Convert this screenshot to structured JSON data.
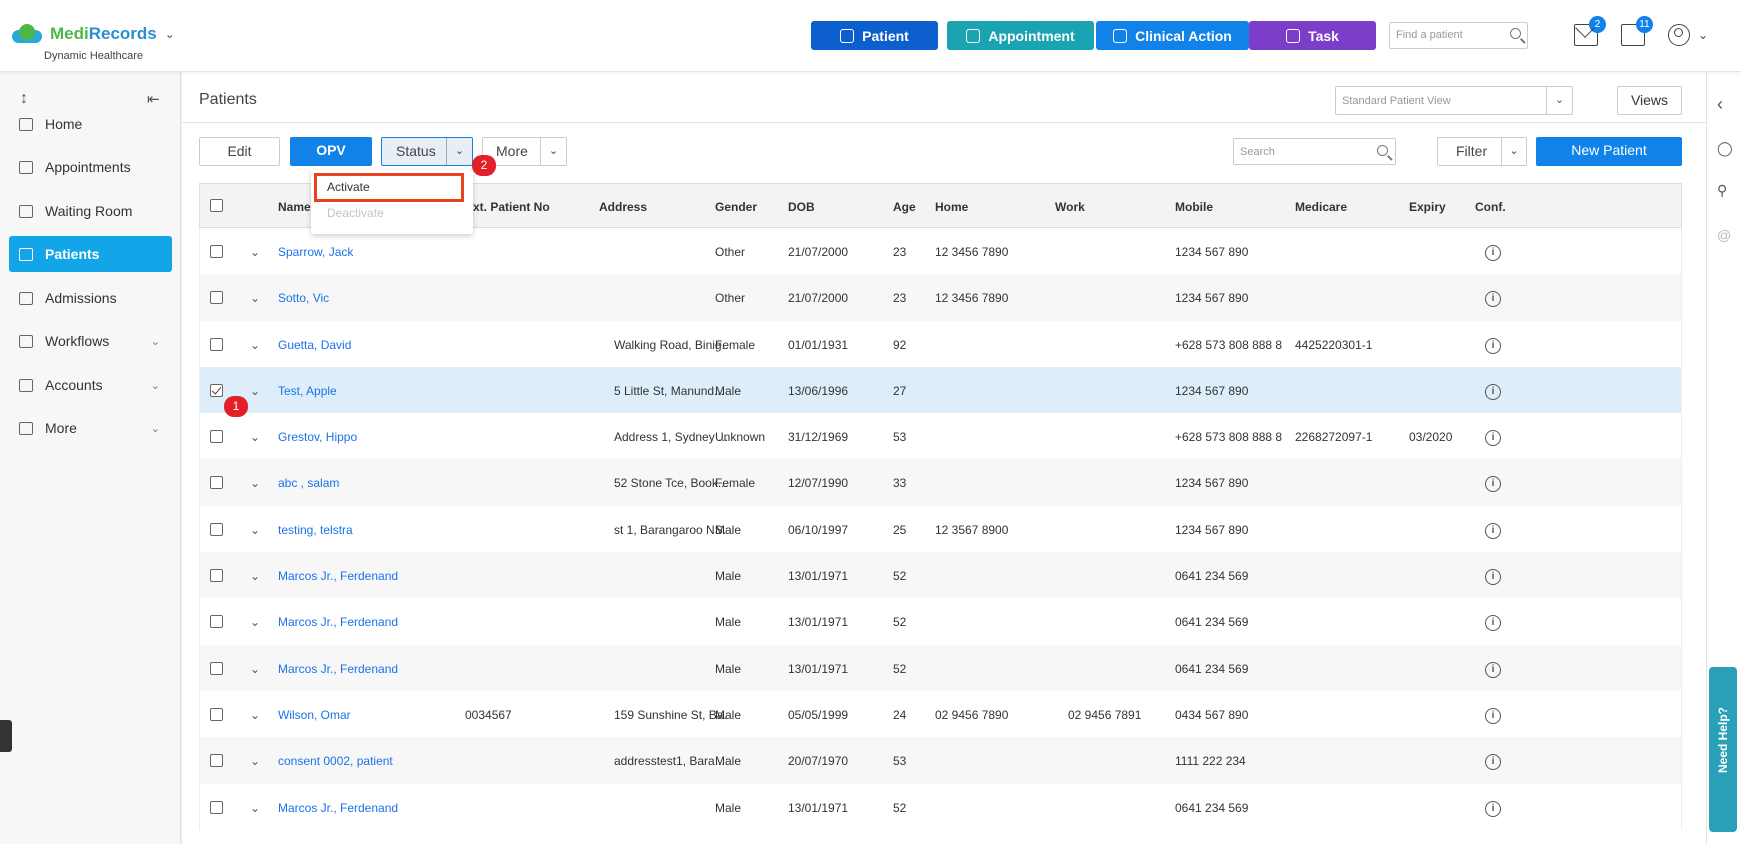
{
  "brand": {
    "name_part1": "Medi",
    "name_part2": "Records",
    "subtitle": "Dynamic Healthcare"
  },
  "header": {
    "buttons": {
      "patient": "Patient",
      "appointment": "Appointment",
      "clinical_action": "Clinical Action",
      "task": "Task"
    },
    "find_placeholder": "Find a patient",
    "mail_count": "2",
    "tasks_count": "11"
  },
  "sidebar": {
    "items": [
      {
        "label": "Home",
        "icon": "home-icon"
      },
      {
        "label": "Appointments",
        "icon": "calendar-icon"
      },
      {
        "label": "Waiting Room",
        "icon": "people-icon"
      },
      {
        "label": "Patients",
        "icon": "patient-icon"
      },
      {
        "label": "Admissions",
        "icon": "building-icon"
      },
      {
        "label": "Workflows",
        "icon": "workflow-icon"
      },
      {
        "label": "Accounts",
        "icon": "folder-icon"
      },
      {
        "label": "More",
        "icon": "folder-arrow-icon"
      }
    ]
  },
  "main": {
    "title": "Patients",
    "view_select": "Standard Patient View",
    "views_label": "Views",
    "toolbar": {
      "edit": "Edit",
      "opv": "OPV",
      "status": "Status",
      "more": "More",
      "search_placeholder": "Search",
      "filter": "Filter",
      "new_patient": "New Patient"
    },
    "status_menu": {
      "activate": "Activate",
      "deactivate": "Deactivate"
    },
    "steps": [
      "1",
      "2"
    ]
  },
  "table": {
    "columns": {
      "name": "Name",
      "ext": "Ext. Patient No",
      "address": "Address",
      "gender": "Gender",
      "dob": "DOB",
      "age": "Age",
      "home": "Home",
      "work": "Work",
      "mobile": "Mobile",
      "medicare": "Medicare",
      "expiry": "Expiry",
      "conf": "Conf."
    },
    "rows": [
      {
        "name": "Sparrow, Jack",
        "ext": "",
        "address": "",
        "gender": "Other",
        "dob": "21/07/2000",
        "age": "23",
        "home": "12 3456 7890",
        "work": "",
        "mobile": "1234 567 890",
        "medicare": "",
        "expiry": ""
      },
      {
        "name": "Sotto, Vic",
        "ext": "",
        "address": "",
        "gender": "Other",
        "dob": "21/07/2000",
        "age": "23",
        "home": "12 3456 7890",
        "work": "",
        "mobile": "1234 567 890",
        "medicare": "",
        "expiry": ""
      },
      {
        "name": "Guetta, David",
        "ext": "",
        "address": "Walking Road, Binig...",
        "gender": "Female",
        "dob": "01/01/1931",
        "age": "92",
        "home": "",
        "work": "",
        "mobile": "+628 573 808 888 8",
        "medicare": "4425220301-1",
        "expiry": ""
      },
      {
        "name": "Test, Apple",
        "ext": "",
        "address": "5 Little St, Manund...",
        "gender": "Male",
        "dob": "13/06/1996",
        "age": "27",
        "home": "",
        "work": "",
        "mobile": "1234 567 890",
        "medicare": "",
        "expiry": ""
      },
      {
        "name": "Grestov, Hippo",
        "ext": "",
        "address": "Address 1, Sydney ...",
        "gender": "Unknown",
        "dob": "31/12/1969",
        "age": "53",
        "home": "",
        "work": "",
        "mobile": "+628 573 808 888 8",
        "medicare": "2268272097-1",
        "expiry": "03/2020"
      },
      {
        "name": "abc , salam",
        "ext": "",
        "address": "52 Stone Tce, Book...",
        "gender": "Female",
        "dob": "12/07/1990",
        "age": "33",
        "home": "",
        "work": "",
        "mobile": "1234 567 890",
        "medicare": "",
        "expiry": ""
      },
      {
        "name": "testing, telstra",
        "ext": "",
        "address": "st 1, Barangaroo NS...",
        "gender": "Male",
        "dob": "06/10/1997",
        "age": "25",
        "home": "12 3567 8900",
        "work": "",
        "mobile": "1234 567 890",
        "medicare": "",
        "expiry": ""
      },
      {
        "name": "Marcos Jr., Ferdenand",
        "ext": "",
        "address": "",
        "gender": "Male",
        "dob": "13/01/1971",
        "age": "52",
        "home": "",
        "work": "",
        "mobile": "0641 234 569",
        "medicare": "",
        "expiry": ""
      },
      {
        "name": "Marcos Jr., Ferdenand",
        "ext": "",
        "address": "",
        "gender": "Male",
        "dob": "13/01/1971",
        "age": "52",
        "home": "",
        "work": "",
        "mobile": "0641 234 569",
        "medicare": "",
        "expiry": ""
      },
      {
        "name": "Marcos Jr., Ferdenand",
        "ext": "",
        "address": "",
        "gender": "Male",
        "dob": "13/01/1971",
        "age": "52",
        "home": "",
        "work": "",
        "mobile": "0641 234 569",
        "medicare": "",
        "expiry": ""
      },
      {
        "name": "Wilson, Omar",
        "ext": "0034567",
        "address": "159 Sunshine St, Ba...",
        "gender": "Male",
        "dob": "05/05/1999",
        "age": "24",
        "home": "02 9456 7890",
        "work": "02 9456 7891",
        "mobile": "0434 567 890",
        "medicare": "",
        "expiry": ""
      },
      {
        "name": "consent 0002, patient",
        "ext": "",
        "address": "addresstest1, Bara...",
        "gender": "Male",
        "dob": "20/07/1970",
        "age": "53",
        "home": "",
        "work": "",
        "mobile": "1111 222 234",
        "medicare": "",
        "expiry": ""
      },
      {
        "name": "Marcos Jr., Ferdenand",
        "ext": "",
        "address": "",
        "gender": "Male",
        "dob": "13/01/1971",
        "age": "52",
        "home": "",
        "work": "",
        "mobile": "0641 234 569",
        "medicare": "",
        "expiry": ""
      }
    ]
  },
  "help": {
    "label": "Need Help?"
  },
  "colors": {
    "primary": "#1082e8",
    "teal": "#1aa3b0",
    "purple": "#7c3dc9",
    "active_nav": "#12a6e8",
    "highlight": "#e8421e"
  }
}
